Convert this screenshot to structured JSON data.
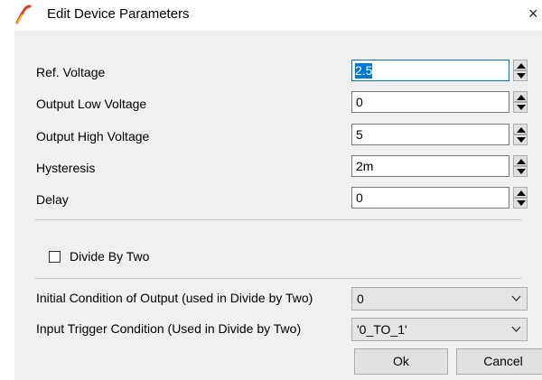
{
  "window": {
    "title": "Edit Device Parameters",
    "close_glyph": "×",
    "icon": "ltspice-icon"
  },
  "fields": [
    {
      "label": "Ref. Voltage",
      "value": "2.5",
      "selected": true
    },
    {
      "label": "Output Low Voltage",
      "value": "0",
      "selected": false
    },
    {
      "label": "Output High Voltage",
      "value": "5",
      "selected": false
    },
    {
      "label": "Hysteresis",
      "value": "2m",
      "selected": false
    },
    {
      "label": "Delay",
      "value": "0",
      "selected": false
    }
  ],
  "checkbox": {
    "label": "Divide By Two",
    "checked": false
  },
  "combos": [
    {
      "label": "Initial Condition of Output (used in Divide by Two)",
      "value": "0"
    },
    {
      "label": "Input Trigger Condition (Used in Divide by Two)",
      "value": "'0_TO_1'"
    }
  ],
  "buttons": {
    "ok": "Ok",
    "cancel": "Cancel"
  },
  "colors": {
    "selection": "#0078d7",
    "client_bg": "#f0f0f0",
    "icon_red": "#e03a1e"
  }
}
